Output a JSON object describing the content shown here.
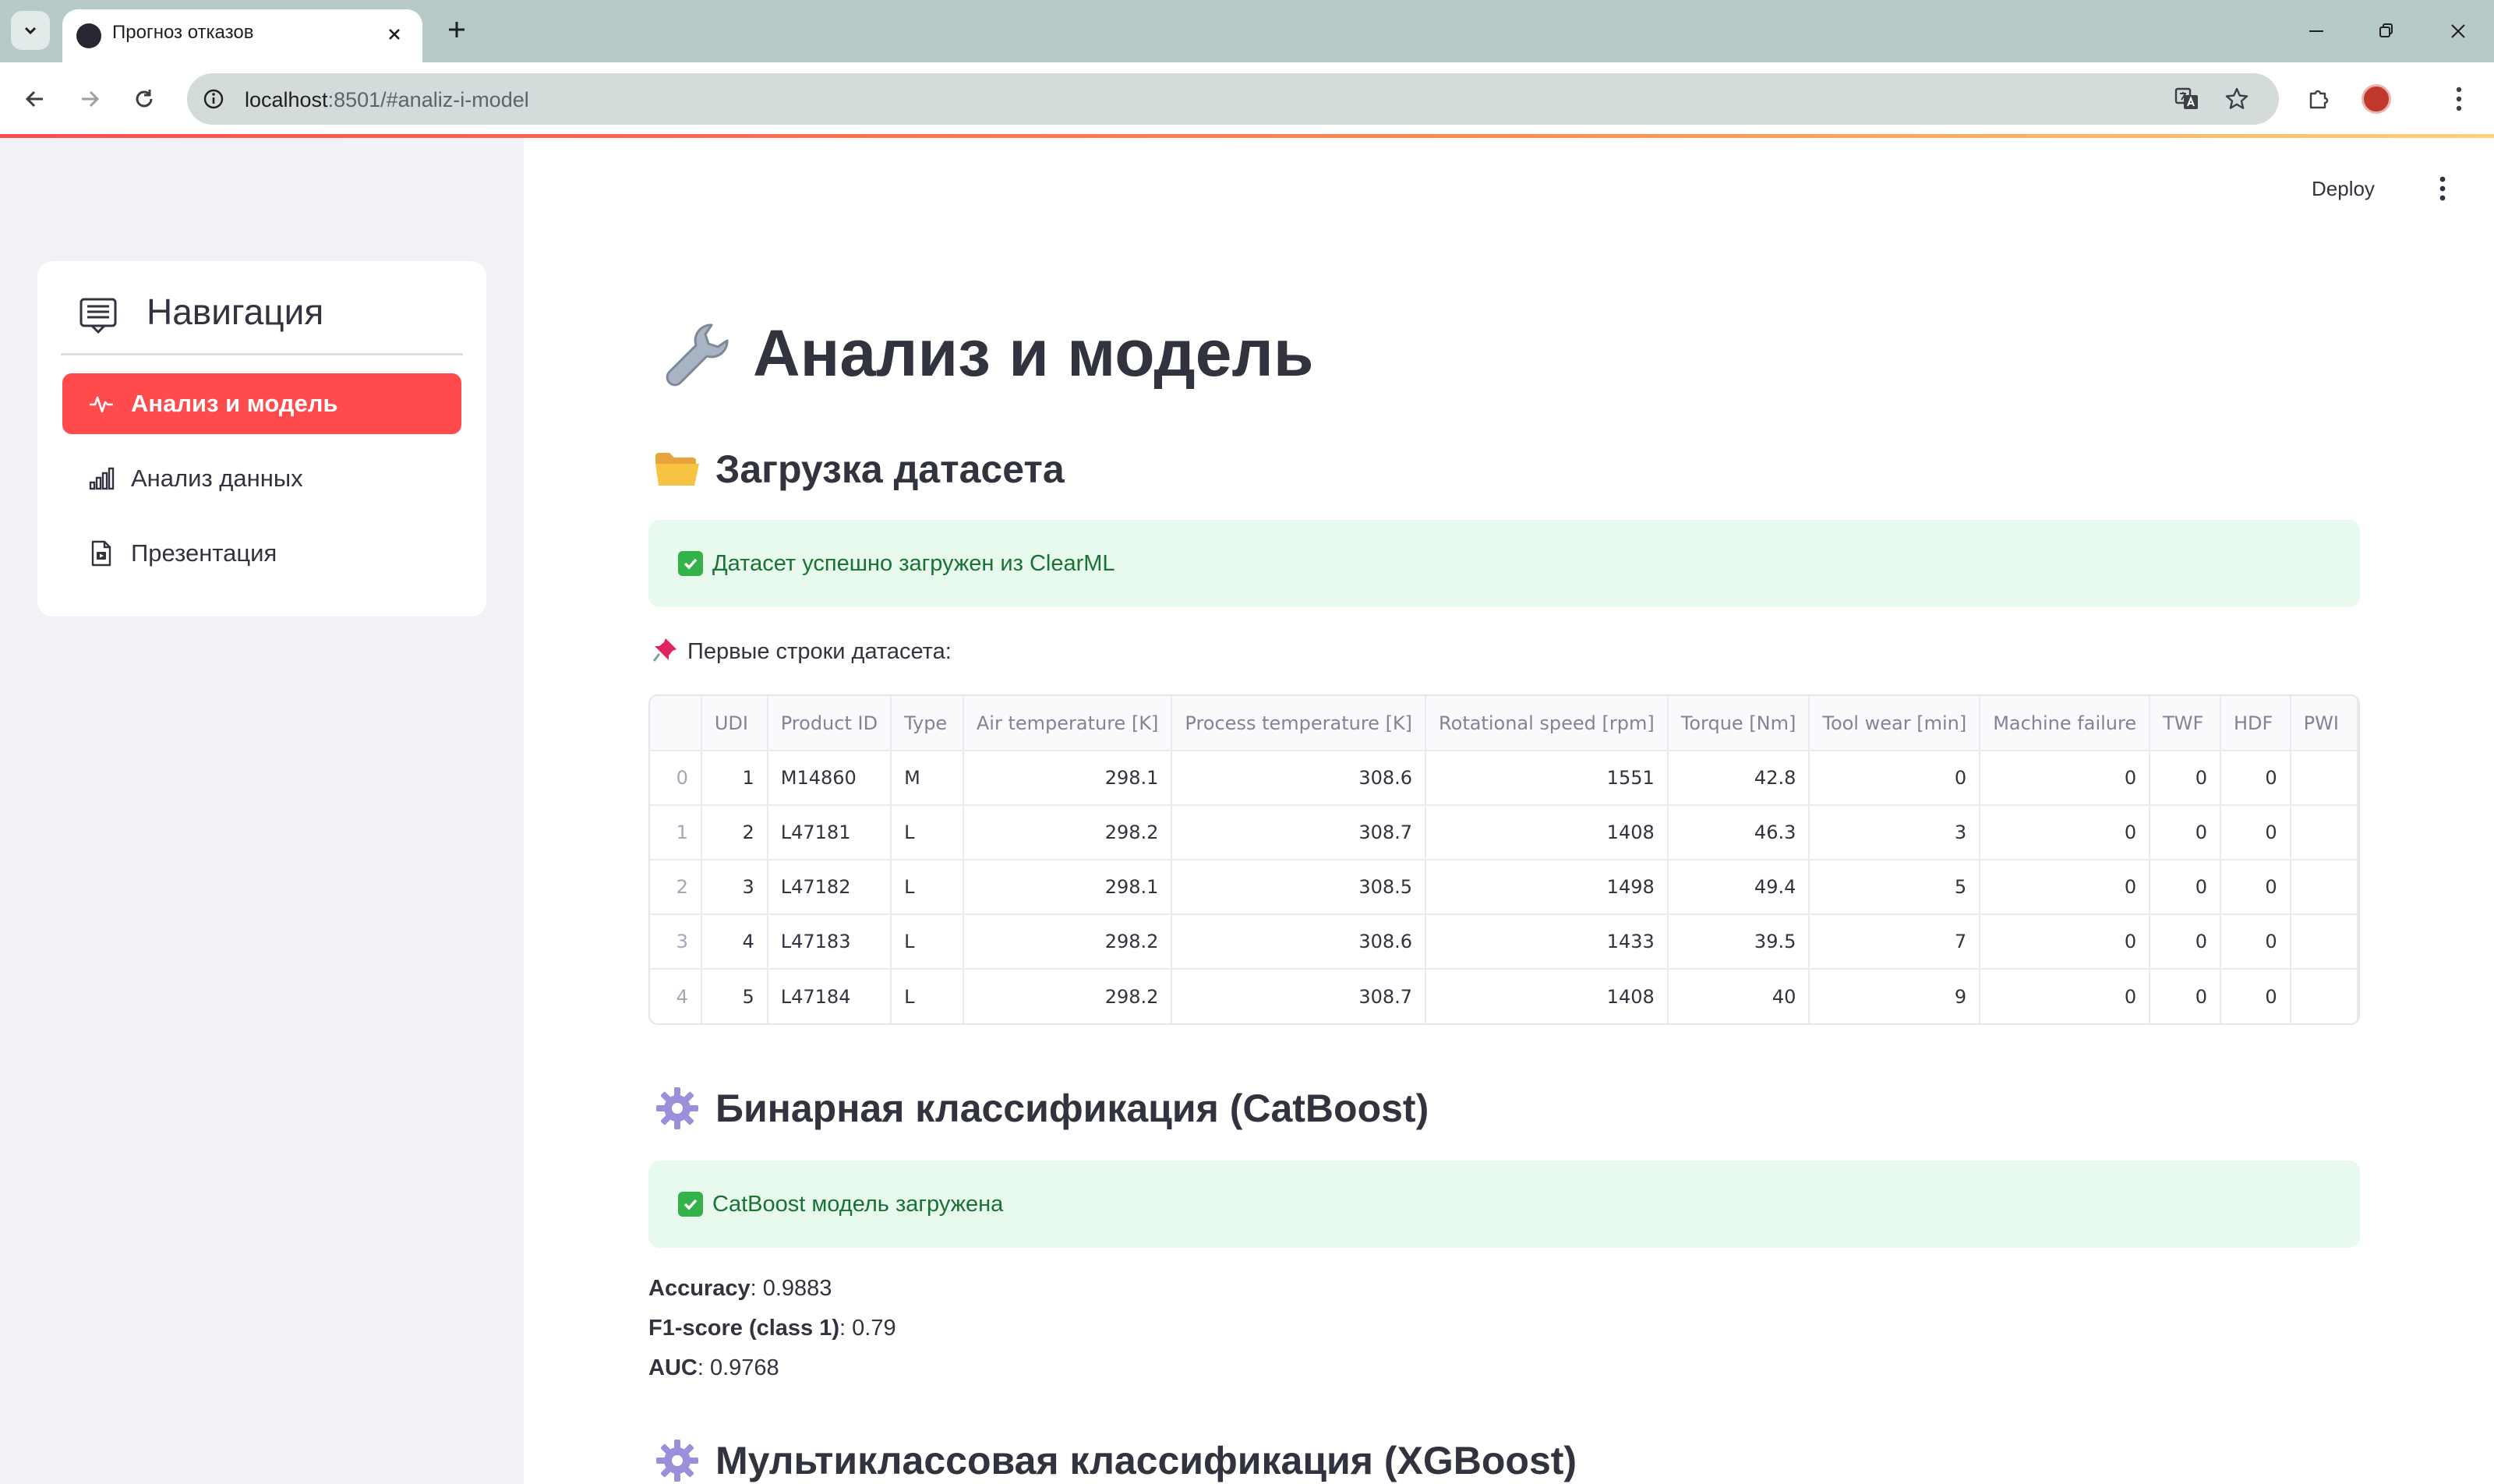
{
  "browser": {
    "tab_title": "Прогноз отказов",
    "url_host": "localhost",
    "url_rest": ":8501/#analiz-i-model"
  },
  "app": {
    "deploy_label": "Deploy"
  },
  "sidebar": {
    "title": "Навигация",
    "items": [
      {
        "label": "Анализ и модель",
        "icon": "activity-icon",
        "active": true
      },
      {
        "label": "Анализ данных",
        "icon": "bar-chart-icon",
        "active": false
      },
      {
        "label": "Презентация",
        "icon": "document-icon",
        "active": false
      }
    ]
  },
  "main": {
    "title": "Анализ и модель",
    "dataset_section": {
      "heading": "Загрузка датасета",
      "success": "Датасет успешно загружен из ClearML",
      "preview_label": "Первые строки датасета:"
    },
    "table": {
      "columns": [
        "",
        "UDI",
        "Product ID",
        "Type",
        "Air temperature [K]",
        "Process temperature [K]",
        "Rotational speed [rpm]",
        "Torque [Nm]",
        "Tool wear [min]",
        "Machine failure",
        "TWF",
        "HDF",
        "PWI"
      ],
      "rows": [
        [
          "0",
          "1",
          "M14860",
          "M",
          "298.1",
          "308.6",
          "1551",
          "42.8",
          "0",
          "0",
          "0",
          "0",
          ""
        ],
        [
          "1",
          "2",
          "L47181",
          "L",
          "298.2",
          "308.7",
          "1408",
          "46.3",
          "3",
          "0",
          "0",
          "0",
          ""
        ],
        [
          "2",
          "3",
          "L47182",
          "L",
          "298.1",
          "308.5",
          "1498",
          "49.4",
          "5",
          "0",
          "0",
          "0",
          ""
        ],
        [
          "3",
          "4",
          "L47183",
          "L",
          "298.2",
          "308.6",
          "1433",
          "39.5",
          "7",
          "0",
          "0",
          "0",
          ""
        ],
        [
          "4",
          "5",
          "L47184",
          "L",
          "298.2",
          "308.7",
          "1408",
          "40",
          "9",
          "0",
          "0",
          "0",
          ""
        ]
      ]
    },
    "binary_section": {
      "heading": "Бинарная классификация (CatBoost)",
      "success": "CatBoost модель загружена",
      "metrics": [
        {
          "name": "Accuracy",
          "value": ": 0.9883"
        },
        {
          "name": "F1-score (class 1)",
          "value": ": 0.79"
        },
        {
          "name": "AUC",
          "value": ": 0.9768"
        }
      ]
    },
    "multi_section": {
      "heading": "Мультиклассовая классификация (XGBoost)"
    }
  }
}
